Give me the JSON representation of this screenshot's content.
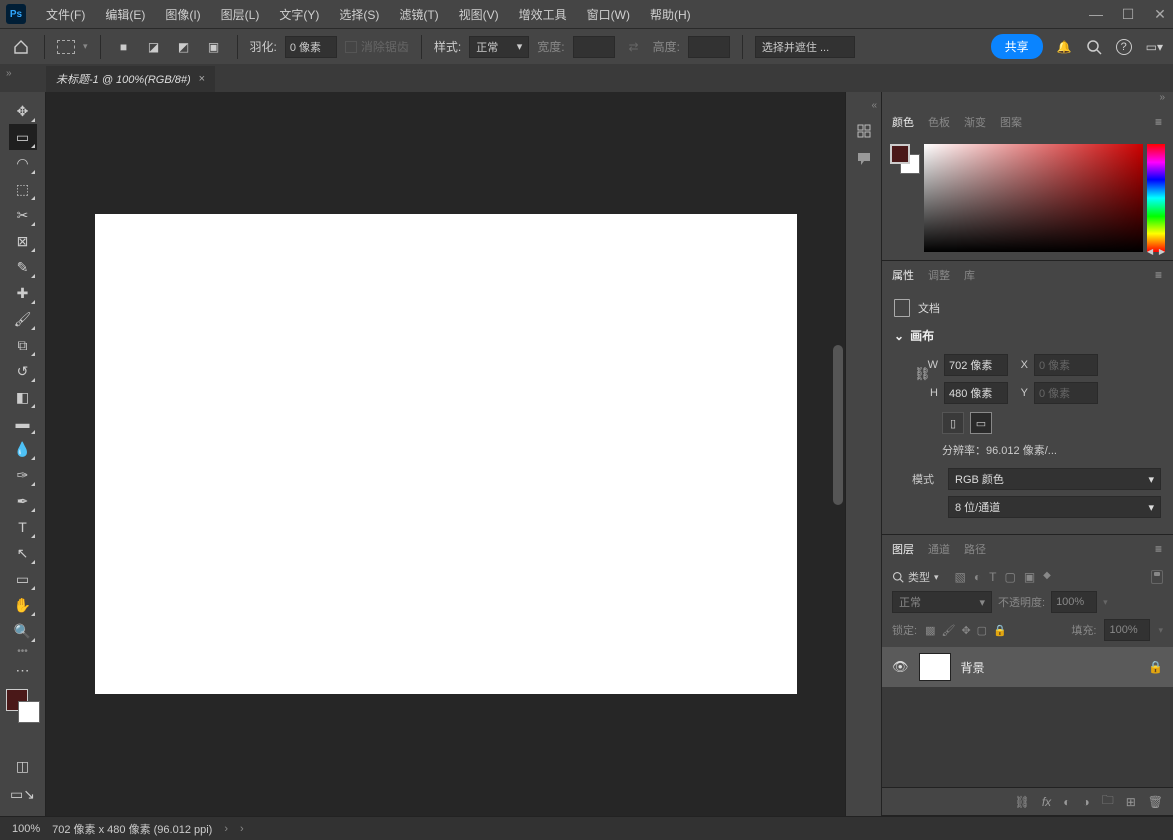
{
  "app": "Ps",
  "menu": [
    "文件(F)",
    "编辑(E)",
    "图像(I)",
    "图层(L)",
    "文字(Y)",
    "选择(S)",
    "滤镜(T)",
    "视图(V)",
    "增效工具",
    "窗口(W)",
    "帮助(H)"
  ],
  "options": {
    "feather_label": "羽化:",
    "feather_value": "0 像素",
    "antialias": "消除锯齿",
    "style_label": "样式:",
    "style_value": "正常",
    "width_label": "宽度:",
    "width_value": "",
    "height_label": "高度:",
    "height_value": "",
    "select_mask_label": "选择并遮住 ...",
    "share_label": "共享"
  },
  "document": {
    "tab_title": "未标题-1 @ 100%(RGB/8#)"
  },
  "tools": [
    {
      "n": "move",
      "g": "✥"
    },
    {
      "n": "marquee",
      "g": "▭",
      "active": true
    },
    {
      "n": "lasso",
      "g": "◠"
    },
    {
      "n": "object-select",
      "g": "⬚"
    },
    {
      "n": "crop",
      "g": "✂"
    },
    {
      "n": "frame",
      "g": "⊠"
    },
    {
      "n": "eyedropper",
      "g": "✎"
    },
    {
      "n": "heal",
      "g": "✚"
    },
    {
      "n": "brush",
      "g": "🖌"
    },
    {
      "n": "stamp",
      "g": "⧉"
    },
    {
      "n": "history-brush",
      "g": "↺"
    },
    {
      "n": "eraser",
      "g": "◧"
    },
    {
      "n": "gradient",
      "g": "▬"
    },
    {
      "n": "blur",
      "g": "💧"
    },
    {
      "n": "dodge",
      "g": "✑"
    },
    {
      "n": "pen",
      "g": "✒"
    },
    {
      "n": "type",
      "g": "T"
    },
    {
      "n": "path-select",
      "g": "↖"
    },
    {
      "n": "shape",
      "g": "▭"
    },
    {
      "n": "hand",
      "g": "✋"
    },
    {
      "n": "zoom",
      "g": "🔍"
    }
  ],
  "color_panel": {
    "tabs": [
      "颜色",
      "色板",
      "渐变",
      "图案"
    ],
    "fg": "#4a1818",
    "bg": "#ffffff"
  },
  "props_panel": {
    "tabs": [
      "属性",
      "调整",
      "库"
    ],
    "doc_label": "文档",
    "canvas_label": "画布",
    "w_label": "W",
    "w_value": "702 像素",
    "h_label": "H",
    "h_value": "480 像素",
    "x_label": "X",
    "x_value": "0 像素",
    "y_label": "Y",
    "y_value": "0 像素",
    "res_label": "分辨率：96.012 像素/...",
    "mode_label": "模式",
    "mode_value": "RGB 颜色",
    "depth_value": "8 位/通道"
  },
  "layers_panel": {
    "tabs": [
      "图层",
      "通道",
      "路径"
    ],
    "filter_label": "类型",
    "blend_mode": "正常",
    "opacity_label": "不透明度:",
    "opacity_value": "100%",
    "lock_label": "锁定:",
    "fill_label": "填充:",
    "fill_value": "100%",
    "layer_name": "背景"
  },
  "status": {
    "zoom": "100%",
    "info": "702 像素 x 480 像素 (96.012 ppi)"
  }
}
